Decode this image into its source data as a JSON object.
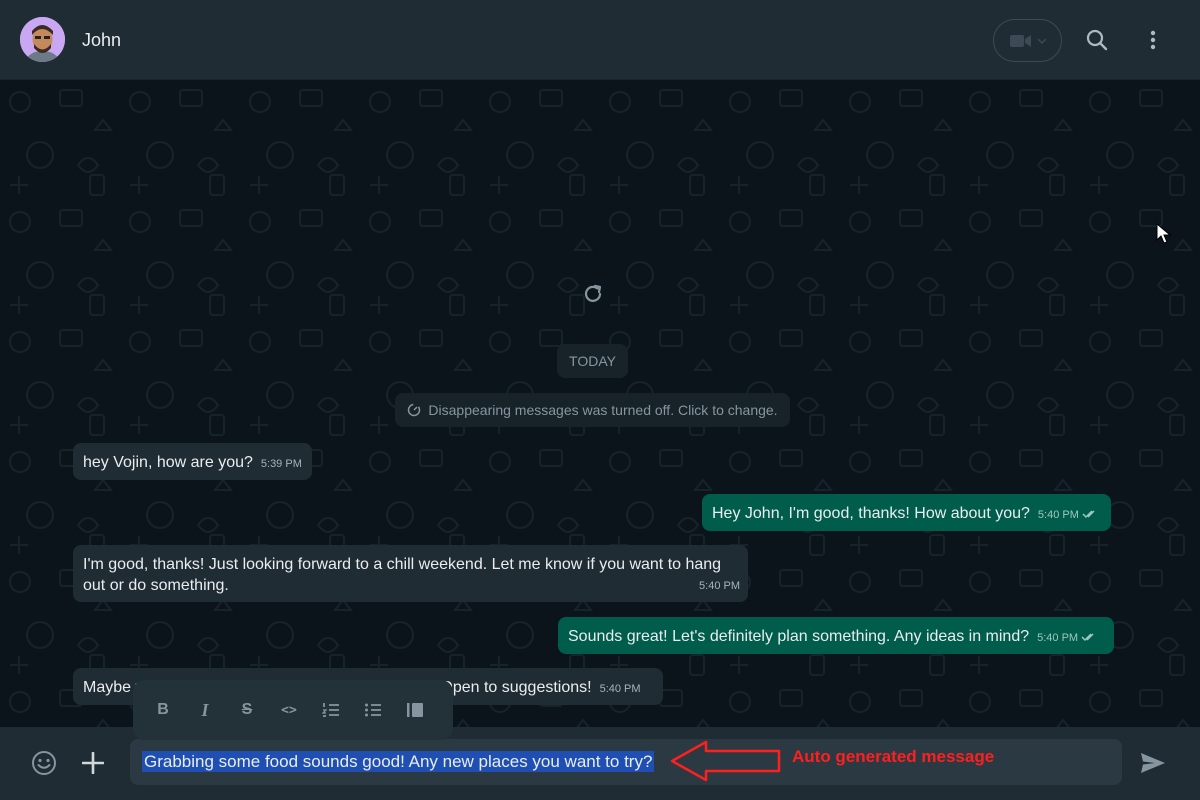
{
  "header": {
    "contact_name": "John",
    "icons": [
      "avatar",
      "video-call-icon",
      "search-icon",
      "menu-icon"
    ]
  },
  "chat": {
    "date_label": "TODAY",
    "system_message": "Disappearing messages was turned off. Click to change.",
    "messages": [
      {
        "direction": "incoming",
        "text": "hey Vojin, how are you?",
        "time": "5:39 PM"
      },
      {
        "direction": "outgoing",
        "text": "Hey John, I'm good, thanks! How about you?",
        "time": "5:40 PM",
        "status": "read"
      },
      {
        "direction": "incoming",
        "text": "I'm good, thanks! Just looking forward to a chill weekend. Let me know if you want to hang out or do something.",
        "time": "5:40 PM"
      },
      {
        "direction": "outgoing",
        "text": "Sounds great! Let's definitely plan something. Any ideas in mind?",
        "time": "5:40 PM",
        "status": "read"
      },
      {
        "direction": "incoming",
        "text_visible_before": "Maybe w",
        "text_visible_after": "? Open to suggestions!",
        "time": "5:40 PM"
      }
    ]
  },
  "format_toolbar": {
    "buttons": [
      "bold-icon",
      "italic-icon",
      "strikethrough-icon",
      "code-icon",
      "numbered-list-icon",
      "bulleted-list-icon",
      "quote-icon"
    ],
    "bold_glyph": "B",
    "italic_glyph": "I",
    "strike_glyph": "S",
    "code_glyph": "<>"
  },
  "composer": {
    "draft_text": "Grabbing some food sounds good! Any new places you want to try?"
  },
  "annotation": {
    "text": "Auto generated message"
  },
  "colors": {
    "header_bg": "#202c33",
    "chat_bg": "#0b141a",
    "incoming_bubble": "#202c33",
    "outgoing_bubble": "#005c4b",
    "selection": "#1f4fb3",
    "annotation_red": "#ff1f1f"
  }
}
